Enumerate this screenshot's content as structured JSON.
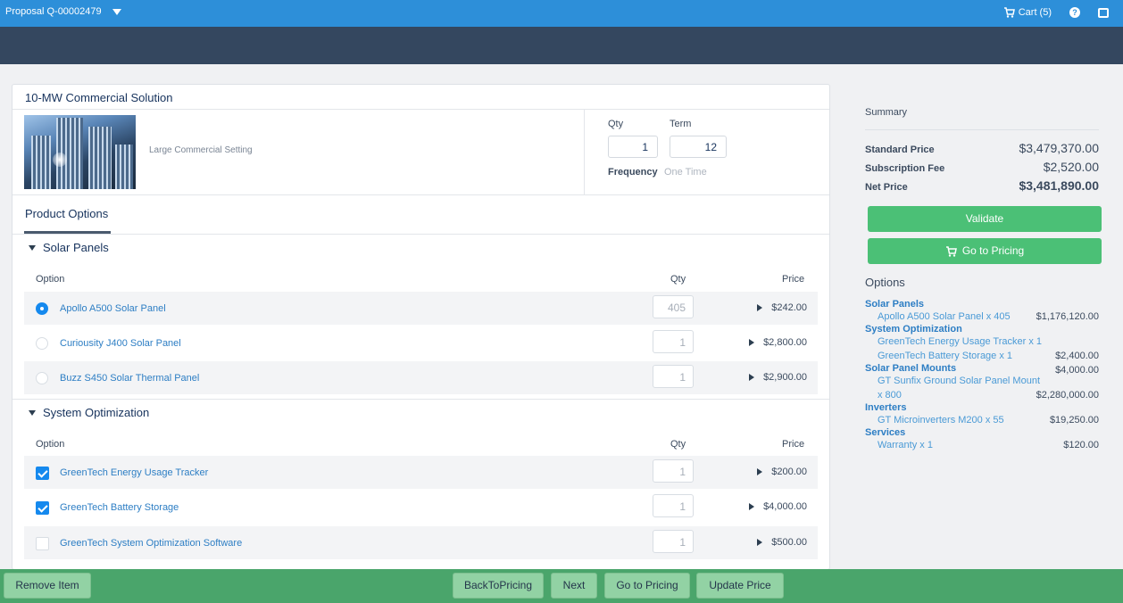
{
  "header": {
    "title": "Proposal Q-00002479",
    "cart_label": "Cart (5)",
    "help_icon": "question-circle-icon",
    "exit_icon": "exit-icon"
  },
  "product": {
    "name": "10-MW Commercial Solution",
    "setting": "Large Commercial Setting",
    "qty_label": "Qty",
    "qty_value": "1",
    "term_label": "Term",
    "term_value": "12",
    "frequency_label": "Frequency",
    "frequency_value": "One Time"
  },
  "tabs": {
    "product_options": "Product Options"
  },
  "sections": {
    "solar_panels": {
      "title": "Solar Panels",
      "col_option": "Option",
      "col_qty": "Qty",
      "col_price": "Price",
      "rows": [
        {
          "name": "Apollo A500 Solar Panel",
          "qty": "405",
          "price": "$242.00",
          "selected": true
        },
        {
          "name": "Curiousity J400 Solar Panel",
          "qty": "1",
          "price": "$2,800.00",
          "selected": false
        },
        {
          "name": "Buzz S450 Solar Thermal Panel",
          "qty": "1",
          "price": "$2,900.00",
          "selected": false
        }
      ]
    },
    "system_optimization": {
      "title": "System Optimization",
      "col_option": "Option",
      "col_qty": "Qty",
      "col_price": "Price",
      "rows": [
        {
          "name": "GreenTech Energy Usage Tracker",
          "qty": "1",
          "price": "$200.00",
          "checked": true
        },
        {
          "name": "GreenTech Battery Storage",
          "qty": "1",
          "price": "$4,000.00",
          "checked": true
        },
        {
          "name": "GreenTech System Optimization Software",
          "qty": "1",
          "price": "$500.00",
          "checked": false
        }
      ]
    }
  },
  "summary": {
    "title": "Summary",
    "standard_price_label": "Standard Price",
    "standard_price": "$3,479,370.00",
    "subscription_fee_label": "Subscription Fee",
    "subscription_fee": "$2,520.00",
    "net_price_label": "Net Price",
    "net_price": "$3,481,890.00",
    "validate_label": "Validate",
    "go_to_pricing_label": "Go to Pricing"
  },
  "options_summary": {
    "title": "Options",
    "groups": {
      "solar_panels": "Solar Panels",
      "system_optimization": "System Optimization",
      "solar_panel_mounts": "Solar Panel Mounts",
      "inverters": "Inverters",
      "services": "Services"
    },
    "items": {
      "apollo": {
        "name": "Apollo A500 Solar Panel x 405",
        "value": "$1,176,120.00"
      },
      "tracker": {
        "name": "GreenTech Energy Usage Tracker x 1",
        "value": ""
      },
      "battery": {
        "name": "GreenTech Battery Storage x 1",
        "value": "$2,400.00"
      },
      "mounts_total": "$4,000.00",
      "sunfix_line1": "GT Sunfix Ground Solar Panel Mount",
      "sunfix_line2": "x 800",
      "sunfix_value": "$2,280,000.00",
      "micro": {
        "name": "GT Microinverters M200 x 55",
        "value": "$19,250.00"
      },
      "warranty": {
        "name": "Warranty x 1",
        "value": "$120.00"
      }
    }
  },
  "footer": {
    "remove_item": "Remove Item",
    "back_to_pricing": "BackToPricing",
    "next": "Next",
    "go_to_pricing": "Go to Pricing",
    "update_price": "Update Price"
  },
  "colors": {
    "top_bar": "#2d8fd9",
    "nav_band": "#34475f",
    "accent_green": "#4bc076",
    "footer": "#4aa56b",
    "link_blue": "#2d7ec4"
  }
}
